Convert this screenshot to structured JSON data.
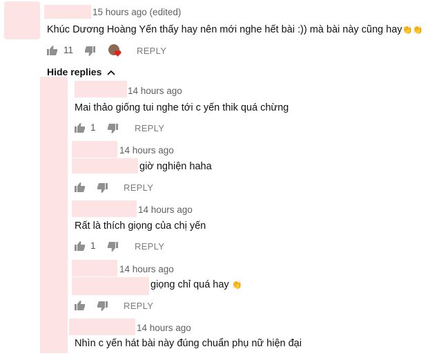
{
  "top_comment": {
    "time": "15 hours ago (edited)",
    "text": "Khúc Dương Hoàng Yến thấy hay nên mới nghe hết bài :)) mà bài này cũng hay",
    "emoji": "👏👏",
    "likes": "11",
    "reply_label": "REPLY"
  },
  "hide_replies_label": "Hide replies",
  "replies": [
    {
      "time": "14 hours ago",
      "text": "Mai thảo giống tui nghe tới c yến thik quá chừng",
      "likes": "1",
      "reply_label": "REPLY"
    },
    {
      "time": "14 hours ago",
      "text": "giờ nghiện haha",
      "likes": "",
      "reply_label": "REPLY"
    },
    {
      "time": "14 hours ago",
      "text": "Rất là thích giọng của chị yến",
      "likes": "1",
      "reply_label": "REPLY"
    },
    {
      "time": "14 hours ago",
      "text": "giọng chỉ quá hay",
      "emoji": "👏",
      "likes": "",
      "reply_label": "REPLY"
    },
    {
      "time": "14 hours ago",
      "text": "Nhìn c yến hát bài này đúng chuẩn phụ nữ hiện đại"
    }
  ],
  "colors": {
    "redaction": "#fde3e3",
    "heart": "#e62117",
    "meta_text": "#5f5f5f"
  }
}
